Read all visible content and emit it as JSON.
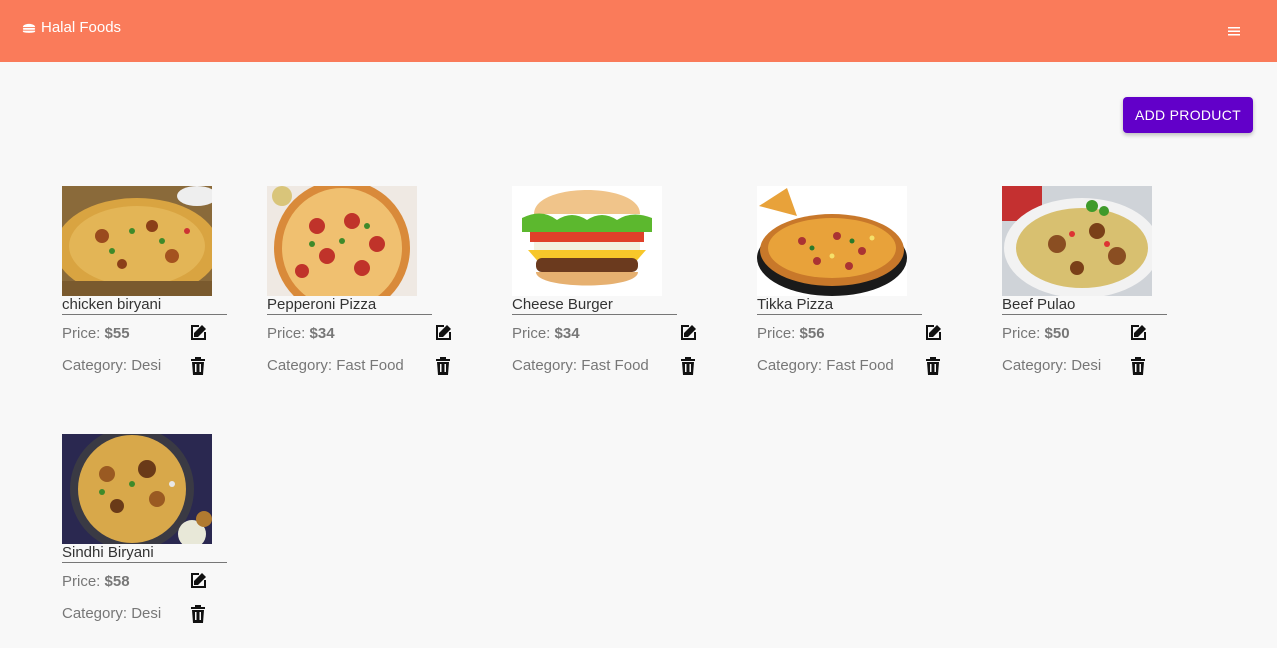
{
  "navbar": {
    "brand_icon": "hamburger-food-icon",
    "brand_title": "Halal Foods",
    "menu_icon": "menu-icon",
    "background": "#fa7b5a"
  },
  "toolbar": {
    "add_product_label": "ADD PRODUCT",
    "accent": "#6200c9"
  },
  "labels": {
    "price": "Price:",
    "category": "Category:"
  },
  "products": [
    {
      "name": "chicken biryani",
      "price": "$55",
      "category": "Desi",
      "image": "biryani-image"
    },
    {
      "name": "Pepperoni Pizza",
      "price": "$34",
      "category": "Fast Food",
      "image": "pepperoni-pizza-image"
    },
    {
      "name": "Cheese Burger",
      "price": "$34",
      "category": "Fast Food",
      "image": "cheese-burger-image"
    },
    {
      "name": "Tikka Pizza",
      "price": "$56",
      "category": "Fast Food",
      "image": "tikka-pizza-image"
    },
    {
      "name": "Beef Pulao",
      "price": "$50",
      "category": "Desi",
      "image": "pulao-image"
    },
    {
      "name": "Sindhi Biryani",
      "price": "$58",
      "category": "Desi",
      "image": "sindhi-biryani-image"
    }
  ]
}
